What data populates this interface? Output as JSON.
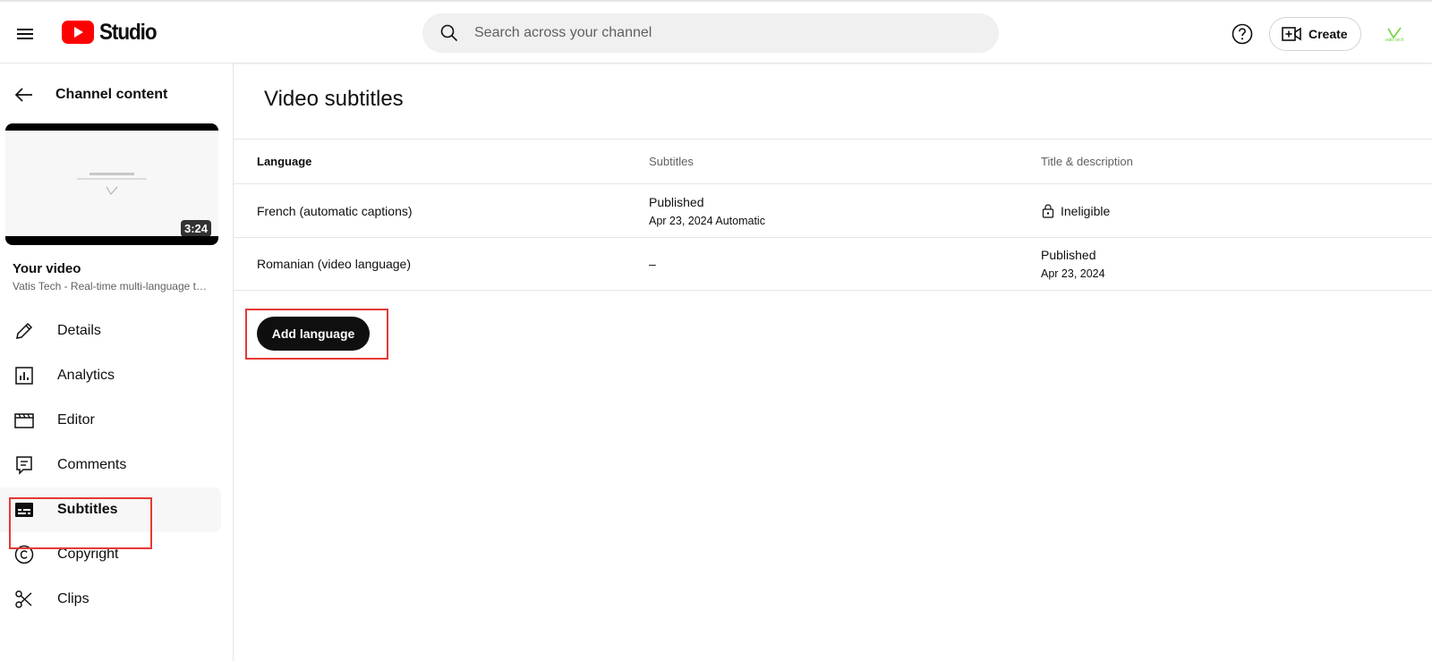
{
  "header": {
    "logo_text": "Studio",
    "search_placeholder": "Search across your channel",
    "create_label": "Create",
    "avatar_text": "vatis tech"
  },
  "sidebar": {
    "back_label": "Channel content",
    "thumbnail_duration": "3:24",
    "your_video_label": "Your video",
    "video_title": "Vatis Tech - Real-time multi-language transcription",
    "items": [
      {
        "label": "Details",
        "icon": "pencil-icon"
      },
      {
        "label": "Analytics",
        "icon": "analytics-icon"
      },
      {
        "label": "Editor",
        "icon": "clapperboard-icon"
      },
      {
        "label": "Comments",
        "icon": "comment-icon"
      },
      {
        "label": "Subtitles",
        "icon": "subtitles-icon",
        "active": true
      },
      {
        "label": "Copyright",
        "icon": "copyright-icon"
      },
      {
        "label": "Clips",
        "icon": "scissors-icon"
      }
    ]
  },
  "main": {
    "title": "Video subtitles",
    "columns": [
      "Language",
      "Subtitles",
      "Title & description"
    ],
    "rows": [
      {
        "language": "French (automatic captions)",
        "subtitles_status": "Published",
        "subtitles_detail": "Apr 23, 2024 Automatic",
        "title_desc_status": "Ineligible",
        "title_desc_detail": ""
      },
      {
        "language": "Romanian (video language)",
        "subtitles_status": "–",
        "subtitles_detail": "",
        "title_desc_status": "Published",
        "title_desc_detail": "Apr 23, 2024"
      }
    ],
    "add_button_label": "Add language"
  },
  "colors": {
    "brand_red": "#ff0000",
    "highlight_red": "#e53935",
    "avatar_green": "#6dd33b"
  }
}
